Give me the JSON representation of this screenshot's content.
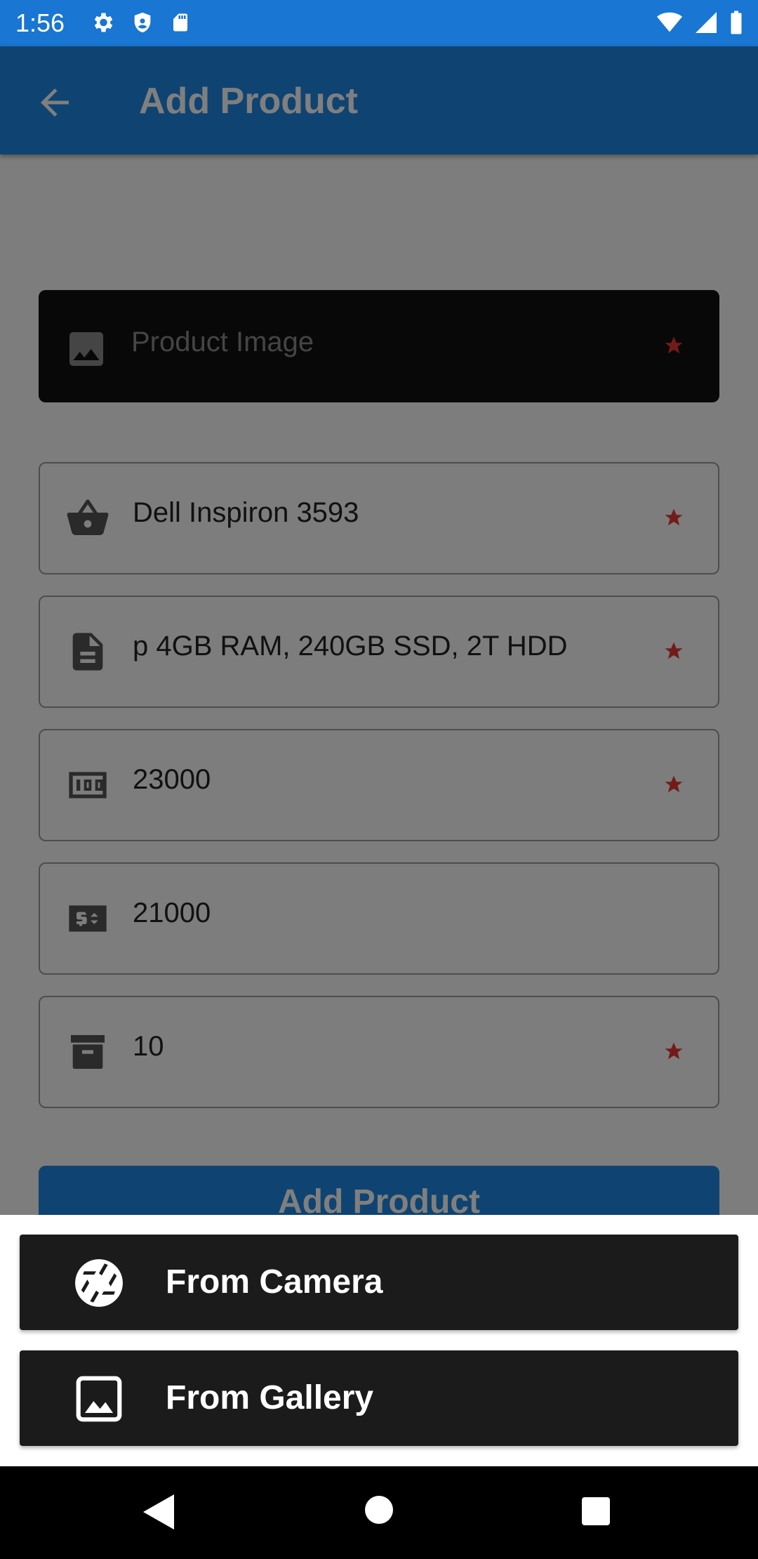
{
  "status_bar": {
    "time": "1:56"
  },
  "app_bar": {
    "title": "Add Product"
  },
  "form": {
    "image_placeholder": "Product Image",
    "name_value": "Dell Inspiron 3593",
    "description_value": "p 4GB RAM, 240GB SSD, 2T HDD",
    "price_value": "23000",
    "sale_price_value": "21000",
    "stock_value": "10"
  },
  "submit_button": {
    "label": "Add Product"
  },
  "image_source_sheet": {
    "camera_label": "From Camera",
    "gallery_label": "From Gallery"
  },
  "colors": {
    "primary": "#1e88e5",
    "status_bar": "#1976d2",
    "required_star": "#e53935",
    "sheet_button": "#1b1b1b"
  }
}
